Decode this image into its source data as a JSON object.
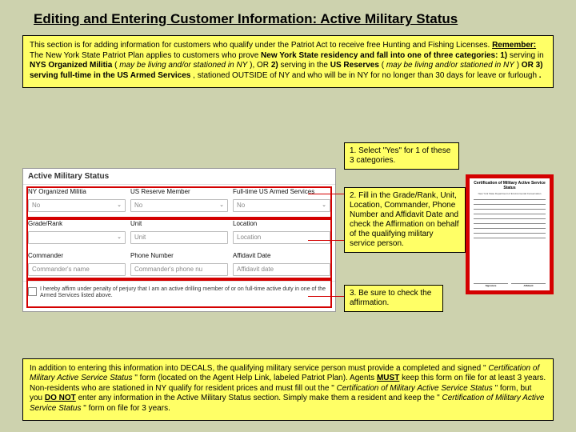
{
  "title": "Editing and Entering Customer Information: Active Military Status",
  "top_box": {
    "intro": "This section is for adding information for customers who qualify under the Patriot Act to receive free Hunting and Fishing Licenses. ",
    "remember_label": "Remember:",
    "remember_text": " The New York State Patriot Plan applies to customers who prove ",
    "cond_lead": "New York State residency and fall into one of three categories: 1) ",
    "cat1a": "serving in ",
    "cat1b": "NYS Organized Militia",
    "cat1c": " (",
    "cat1d": "may be living and/or stationed in NY",
    "cat1e": "), OR ",
    "cat2a": "2) ",
    "cat2b": "serving in the ",
    "cat2c": "US Reserves",
    "cat2d": " (",
    "cat2e": "may be living and/or stationed in NY",
    "cat2f": ") ",
    "cat3a": "OR  3) ",
    "cat3b": "serving full-time in the US Armed Services",
    "cat3c": ", stationed OUTSIDE of NY and who will be in NY for no longer than 30 days for leave or furlough",
    "period": "."
  },
  "form": {
    "header": "Active Military Status",
    "col1_label": "NY Organized Militia",
    "col2_label": "US Reserve Member",
    "col3_label": "Full-time US Armed Services",
    "no": "No",
    "grade": "Grade/Rank",
    "unit": "Unit",
    "unit_ph": "Unit",
    "location": "Location",
    "location_ph": "Location",
    "commander": "Commander",
    "commander_ph": "Commander's name",
    "phone": "Phone Number",
    "phone_ph": "Commander's phone nu",
    "affidavit": "Affidavit Date",
    "affidavit_ph": "Affidavit date",
    "affirm": "I hereby affirm under penalty of perjury that I am an active drilling member of or on full-time active duty in one of the Armed Services listed above."
  },
  "callouts": {
    "c1": "1. Select \"Yes\" for 1 of these 3 categories.",
    "c2": "2. Fill in the Grade/Rank, Unit, Location, Commander, Phone Number and Affidavit Date and check the Affirmation on behalf of the qualifying military service person.",
    "c3": "3. Be sure to check the affirmation."
  },
  "cert": {
    "title": "Certification of Military Active Service Status",
    "sub": "New York State Department of Environmental Conservation",
    "sig": "Signature",
    "aff": "Affidavit"
  },
  "bottom_box": {
    "p1a": "In addition to entering this information into DECALS, the qualifying military service person must provide a completed and signed \"",
    "p1b": "Certification of Military Active Service Status",
    "p1c": "\" form (located on the Agent Help Link, labeled Patriot Plan). Agents ",
    "must": "MUST",
    "p1d": " keep this form on file for at least 3 years. Non-residents who are stationed in NY qualify for resident prices and must fill out the \"",
    "p1e": "Certification of Military Active Service Status",
    "p1f": "\" form, but you ",
    "donot": "DO NOT",
    "p1g": " enter any information in the Active Military Status section. Simply make them a resident and keep the \"",
    "p1h": "Certification of Military Active Service Status",
    "p1i": "\" form on file for 3 years."
  }
}
